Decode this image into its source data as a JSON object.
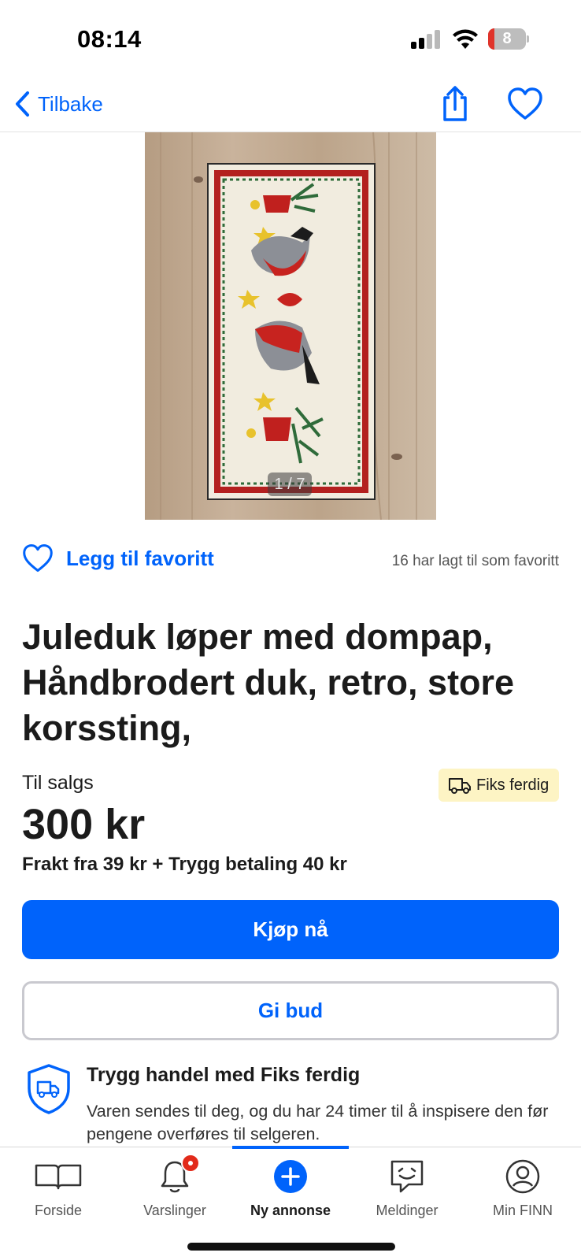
{
  "status_bar": {
    "time": "08:14",
    "battery_level": "8"
  },
  "nav": {
    "back_label": "Tilbake"
  },
  "listing": {
    "image_counter": "1 / 7",
    "favorite_label": "Legg til favoritt",
    "favorite_count_text": "16 har lagt til som favoritt",
    "title": "Juleduk løper med dompap, Håndbrodert duk, retro, store korssting,",
    "sale_type": "Til salgs",
    "badge_label": "Fiks ferdig",
    "price": "300 kr",
    "shipping_text": "Frakt fra 39 kr + Trygg betaling 40 kr",
    "buy_button": "Kjøp nå",
    "bid_button": "Gi bud",
    "safe_trade_title": "Trygg handel med Fiks ferdig",
    "safe_trade_text": "Varen sendes til deg, og du har 24 timer til å inspisere den før pengene overføres til selgeren."
  },
  "tabs": [
    {
      "label": "Forside",
      "icon": "book-icon"
    },
    {
      "label": "Varslinger",
      "icon": "bell-icon"
    },
    {
      "label": "Ny annonse",
      "icon": "plus-circle-icon",
      "active": true
    },
    {
      "label": "Meldinger",
      "icon": "message-icon"
    },
    {
      "label": "Min FINN",
      "icon": "profile-icon"
    }
  ],
  "colors": {
    "accent": "#0063fb",
    "badge_bg": "#fdf4c4",
    "notification": "#e22a1a"
  }
}
